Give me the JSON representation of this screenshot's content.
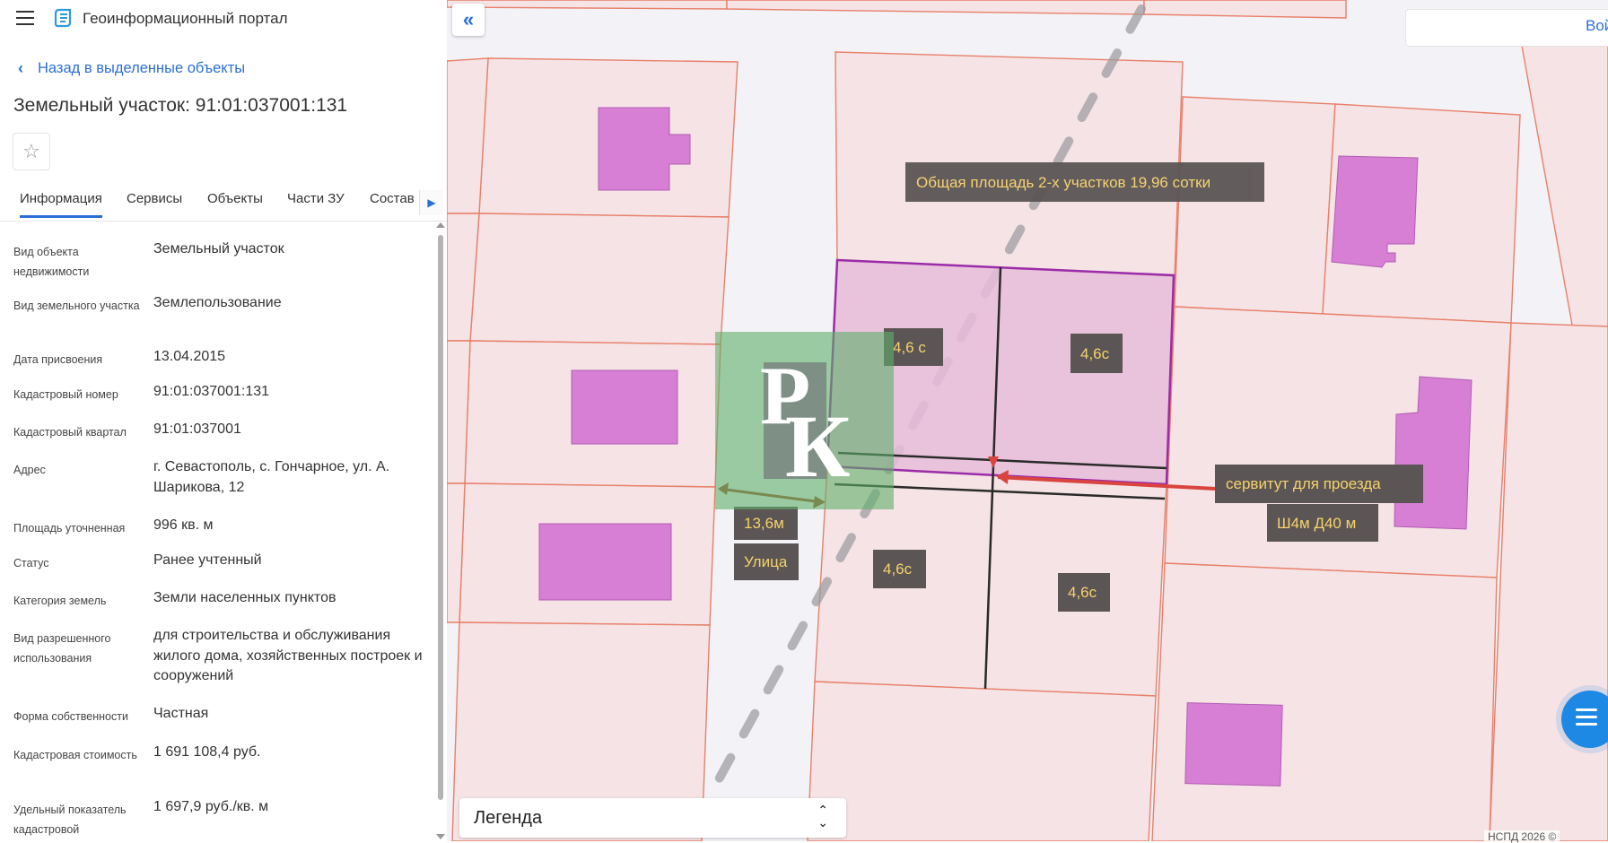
{
  "header": {
    "app_title": "Геоинформационный портал"
  },
  "back_link": "Назад в выделенные объекты",
  "object_title": "Земельный участок: 91:01:037001:131",
  "tabs": [
    "Информация",
    "Сервисы",
    "Объекты",
    "Части ЗУ",
    "Состав"
  ],
  "info": [
    {
      "label": "Вид объекта недвижимости",
      "value": "Земельный участок"
    },
    {
      "label": "Вид земельного участка",
      "value": "Землепользование"
    },
    {
      "label": "Дата присвоения",
      "value": "13.04.2015"
    },
    {
      "label": "Кадастровый номер",
      "value": "91:01:037001:131"
    },
    {
      "label": "Кадастровый квартал",
      "value": "91:01:037001"
    },
    {
      "label": "Адрес",
      "value": "г. Севастополь, с. Гончарное, ул. А. Шарикова, 12"
    },
    {
      "label": "Площадь уточненная",
      "value": "996 кв. м"
    },
    {
      "label": "Статус",
      "value": "Ранее учтенный"
    },
    {
      "label": "Категория земель",
      "value": "Земли населенных пунктов"
    },
    {
      "label": "Вид разрешенного использования",
      "value": "для строительства и обслуживания жилого дома, хозяйственных построек и сооружений"
    },
    {
      "label": "Форма собственности",
      "value": "Частная"
    },
    {
      "label": "Кадастровая стоимость",
      "value": "1 691 108,4 руб."
    },
    {
      "label": "Удельный показатель кадастровой",
      "value": "1 697,9 руб./кв. м"
    }
  ],
  "map": {
    "annotations": {
      "total_area": "Общая площадь 2-х участков  19,96 сотки",
      "plot_a": "4,6 с",
      "plot_b": "4,6с",
      "plot_c": "4,6с",
      "plot_d": "4,6с",
      "servitude": "сервитут для проезда",
      "servitude_size": "Ш4м Д40 м",
      "width": "13,6м",
      "street": "Улица"
    },
    "watermark": "РК",
    "login": "Вой",
    "legend": "Легенда",
    "copyright": "НСПД 2026 ©"
  },
  "colors": {
    "accent": "#2a6fd6",
    "parcel_fill": "#f5e3e5",
    "parcel_border": "#e8806a",
    "building": "#d67fd4",
    "selected_fill": "#e6bcdb",
    "selected_border": "#9b2ca8",
    "label_bg": "#5c5555",
    "label_text": "#f6d36b"
  }
}
